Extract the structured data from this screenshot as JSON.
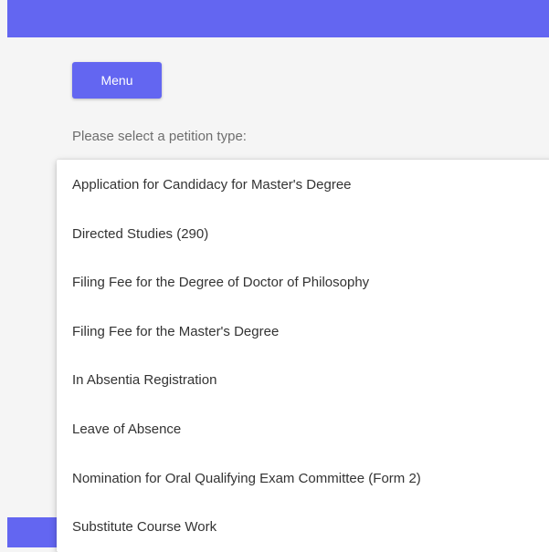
{
  "colors": {
    "accent": "#6366f1",
    "page_background": "#f5f5f5",
    "dropdown_background": "#ffffff",
    "label_text": "#6e6e6e",
    "item_text": "#333333"
  },
  "header": {
    "menu_button_label": "Menu"
  },
  "form": {
    "select_label": "Please select a petition type:"
  },
  "dropdown": {
    "options": [
      {
        "label": "Application for Candidacy for Master's Degree"
      },
      {
        "label": "Directed Studies (290)"
      },
      {
        "label": "Filing Fee for the Degree of Doctor of Philosophy"
      },
      {
        "label": "Filing Fee for the Master's Degree"
      },
      {
        "label": "In Absentia Registration"
      },
      {
        "label": "Leave of Absence"
      },
      {
        "label": "Nomination for Oral Qualifying Exam Committee (Form 2)"
      },
      {
        "label": "Substitute Course Work"
      }
    ]
  }
}
